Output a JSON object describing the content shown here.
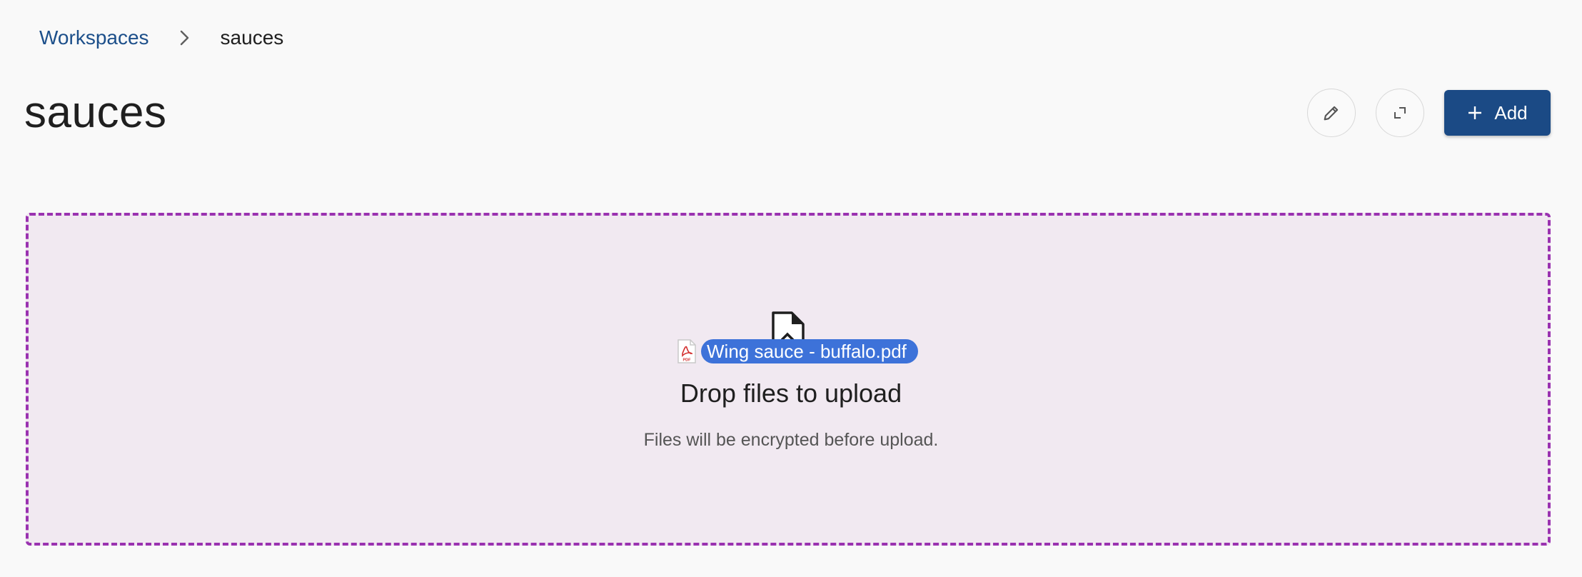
{
  "breadcrumb": {
    "root_label": "Workspaces",
    "current_label": "sauces"
  },
  "header": {
    "title": "sauces",
    "edit_icon": "pencil-icon",
    "expand_icon": "expand-icon",
    "add_label": "Add",
    "add_icon": "plus-icon"
  },
  "dropzone": {
    "icon": "file-upload-icon",
    "dragged_file": {
      "icon": "pdf-icon",
      "name": "Wing sauce - buffalo.pdf"
    },
    "title": "Drop files to upload",
    "subtitle": "Files will be encrypted before upload."
  },
  "colors": {
    "primary": "#1b4a85",
    "link": "#1c4f8a",
    "dropzone_border": "#9a32b0",
    "dropzone_bg": "#f1e9f1",
    "drag_pill": "#3d72d9"
  }
}
